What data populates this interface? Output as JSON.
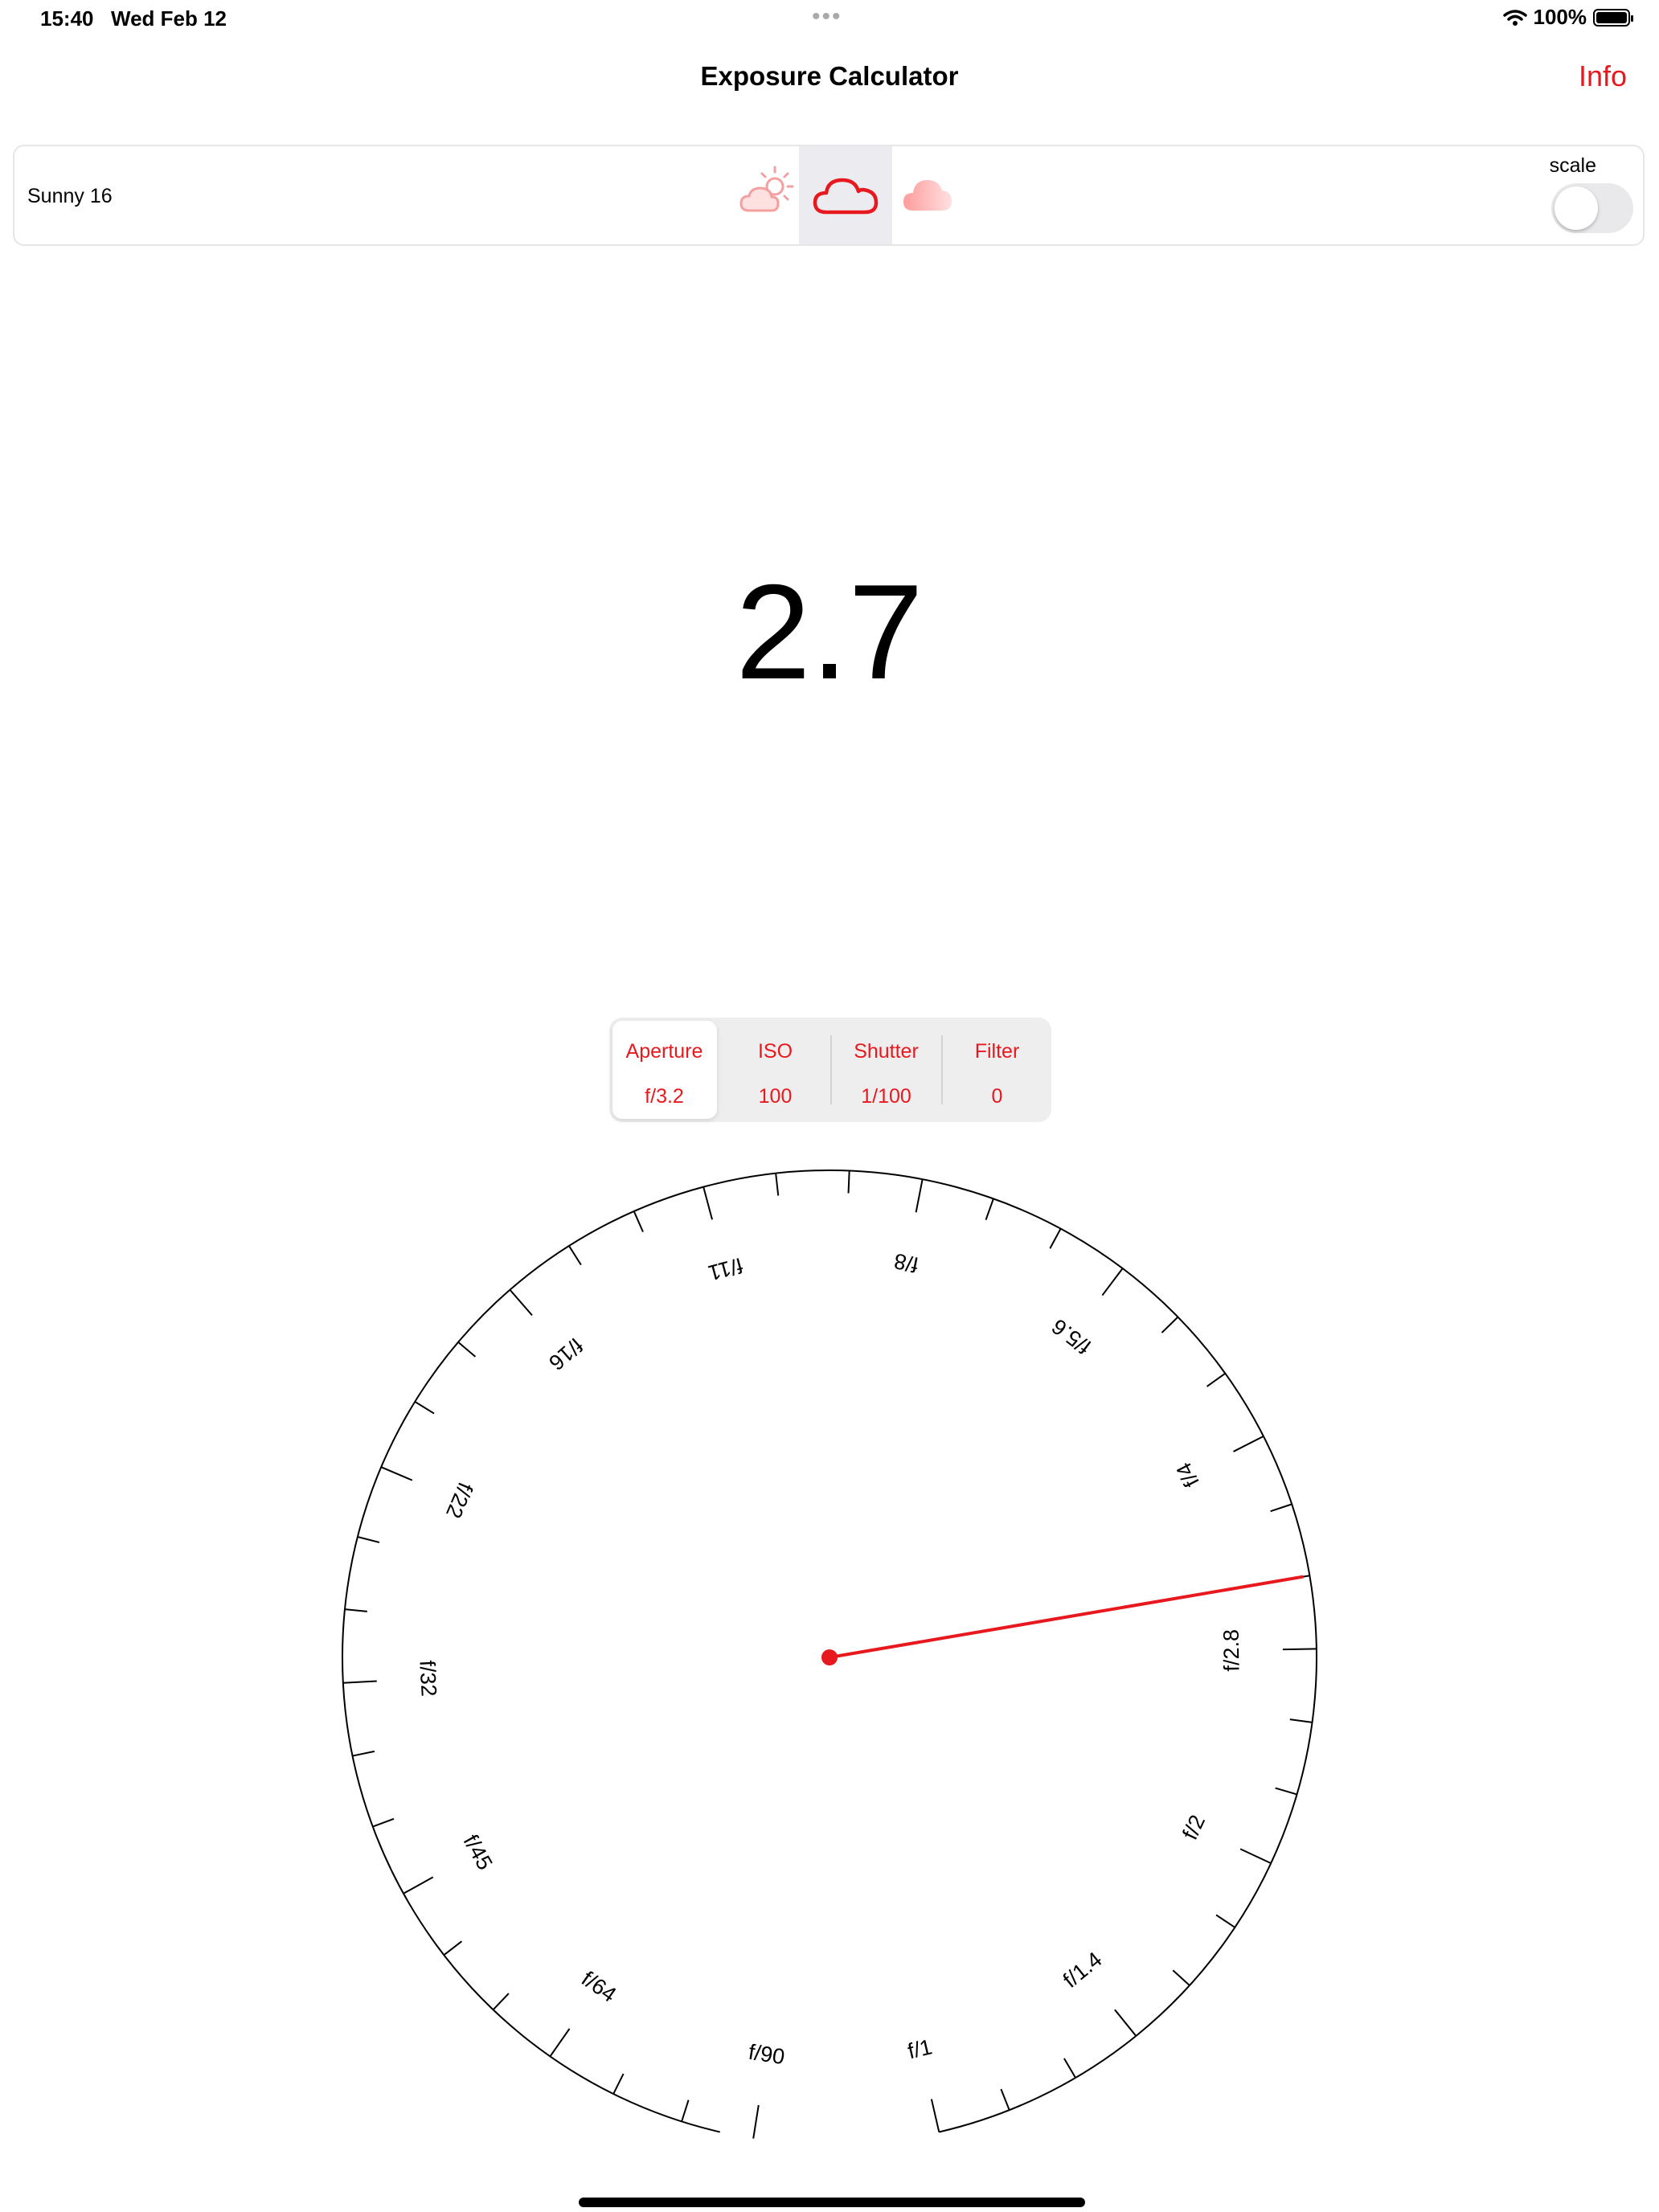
{
  "status_bar": {
    "time": "15:40",
    "date": "Wed Feb 12",
    "battery": "100%"
  },
  "nav": {
    "title": "Exposure Calculator",
    "info_label": "Info"
  },
  "weather": {
    "label": "Sunny 16",
    "options": [
      "sun-behind-cloud-icon",
      "cloud-icon",
      "heavy-cloud-icon"
    ],
    "selected_index": 1,
    "scale_label": "scale",
    "scale_on": false
  },
  "ev_value": "2.7",
  "segments": [
    {
      "title": "Aperture",
      "value": "f/3.2",
      "selected": true
    },
    {
      "title": "ISO",
      "value": "100",
      "selected": false
    },
    {
      "title": "Shutter",
      "value": "1/100",
      "selected": false
    },
    {
      "title": "Filter",
      "value": "0",
      "selected": false
    }
  ],
  "dial": {
    "labels": [
      "f/1",
      "f/1.4",
      "f/2",
      "f/2.8",
      "f/4",
      "f/5.6",
      "f/8",
      "f/11",
      "f/16",
      "f/22",
      "f/32",
      "f/45",
      "f/64",
      "f/90"
    ],
    "current_value": "f/3.2",
    "needle_color": "#e8191e"
  },
  "colors": {
    "accent": "#e8191e",
    "panel_border": "#e6e6e6",
    "segment_bg": "#eeeeef"
  }
}
